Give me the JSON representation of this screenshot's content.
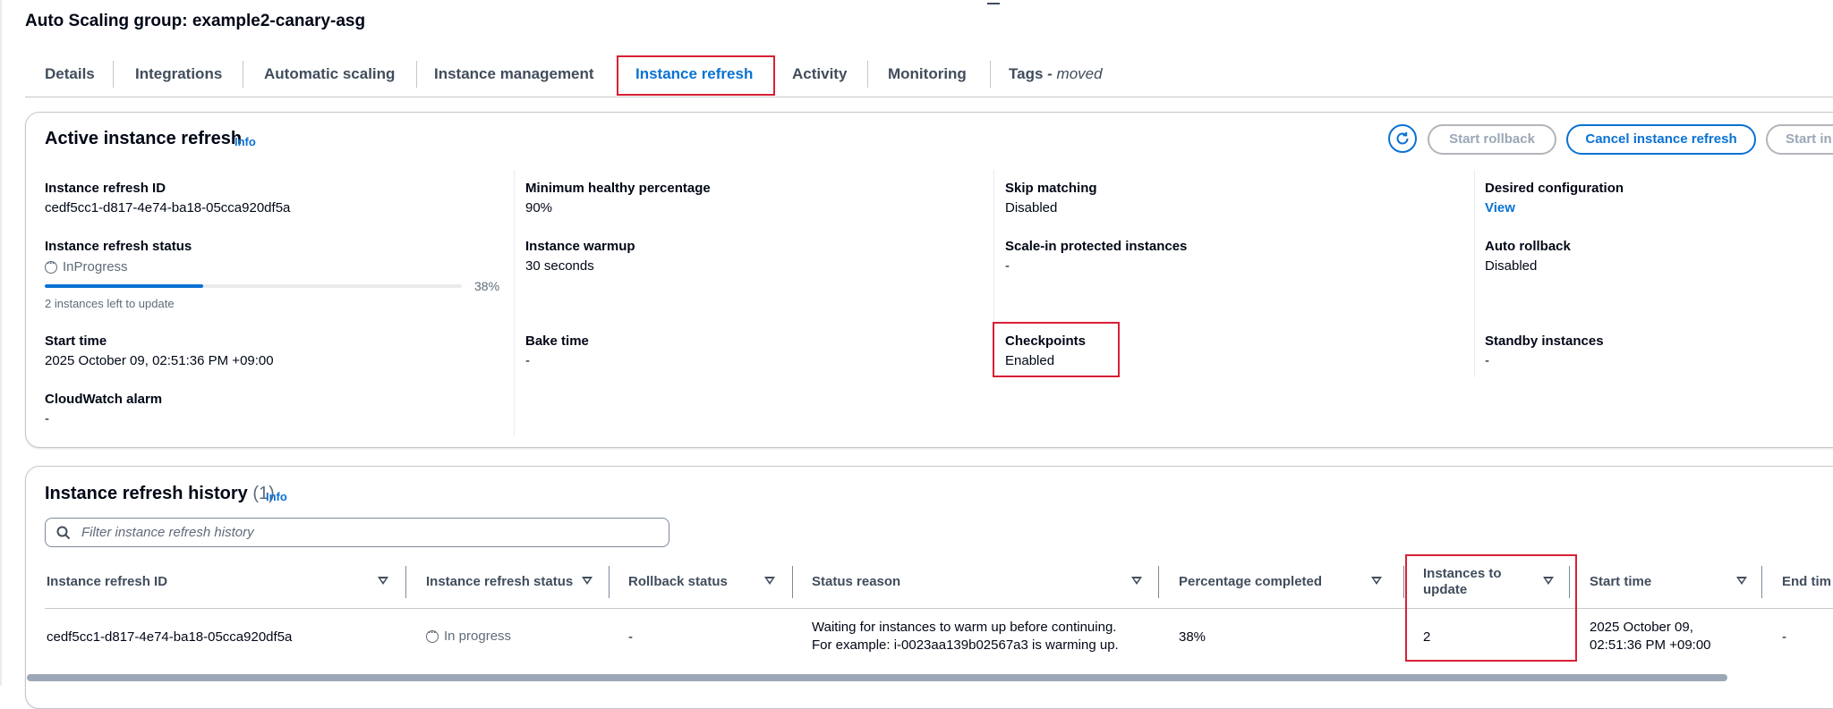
{
  "page": {
    "title": "Auto Scaling group: example2-canary-asg"
  },
  "tabs": [
    {
      "label": "Details"
    },
    {
      "label": "Integrations"
    },
    {
      "label": "Automatic scaling"
    },
    {
      "label": "Instance management"
    },
    {
      "label": "Instance refresh",
      "active": true
    },
    {
      "label": "Activity"
    },
    {
      "label": "Monitoring"
    },
    {
      "label": "Tags - ",
      "suffix": "moved"
    }
  ],
  "active_refresh": {
    "title": "Active instance refresh",
    "info": "Info",
    "buttons": {
      "refresh_icon": "refresh-icon",
      "start_rollback": "Start rollback",
      "cancel": "Cancel instance refresh",
      "start_instance_refresh": "Start in"
    },
    "fields": {
      "refresh_id": {
        "label": "Instance refresh ID",
        "value": "cedf5cc1-d817-4e74-ba18-05cca920df5a"
      },
      "status": {
        "label": "Instance refresh status",
        "value": "InProgress",
        "progress_percent": 38,
        "progress_text": "38%",
        "note": "2 instances left to update"
      },
      "start_time": {
        "label": "Start time",
        "value": "2025 October 09, 02:51:36 PM +09:00"
      },
      "cloudwatch_alarm": {
        "label": "CloudWatch alarm",
        "value": "-"
      },
      "min_healthy": {
        "label": "Minimum healthy percentage",
        "value": "90%"
      },
      "warmup": {
        "label": "Instance warmup",
        "value": "30 seconds"
      },
      "bake_time": {
        "label": "Bake time",
        "value": "-"
      },
      "skip_matching": {
        "label": "Skip matching",
        "value": "Disabled"
      },
      "scale_in_protected": {
        "label": "Scale-in protected instances",
        "value": "-"
      },
      "checkpoints": {
        "label": "Checkpoints",
        "value": "Enabled"
      },
      "desired_config": {
        "label": "Desired configuration",
        "value": "View"
      },
      "auto_rollback": {
        "label": "Auto rollback",
        "value": "Disabled"
      },
      "standby": {
        "label": "Standby instances",
        "value": "-"
      }
    }
  },
  "history": {
    "title": "Instance refresh history",
    "count": "(1)",
    "info": "Info",
    "filter_placeholder": "Filter instance refresh history",
    "columns": {
      "id": "Instance refresh ID",
      "status": "Instance refresh status",
      "rollback": "Rollback status",
      "reason": "Status reason",
      "pct": "Percentage completed",
      "to_update_1": "Instances to",
      "to_update_2": "update",
      "start": "Start time",
      "end": "End tim"
    },
    "rows": [
      {
        "id": "cedf5cc1-d817-4e74-ba18-05cca920df5a",
        "status": "In progress",
        "rollback": "-",
        "reason_1": "Waiting for instances to warm up before continuing.",
        "reason_2": "For example: i-0023aa139b02567a3 is warming up.",
        "pct": "38%",
        "to_update": "2",
        "start_1": "2025 October 09,",
        "start_2": "02:51:36 PM +09:00",
        "end": "-"
      }
    ]
  },
  "colors": {
    "accent": "#0972d3",
    "highlight": "#d91f36",
    "border": "#c6c6cd"
  }
}
